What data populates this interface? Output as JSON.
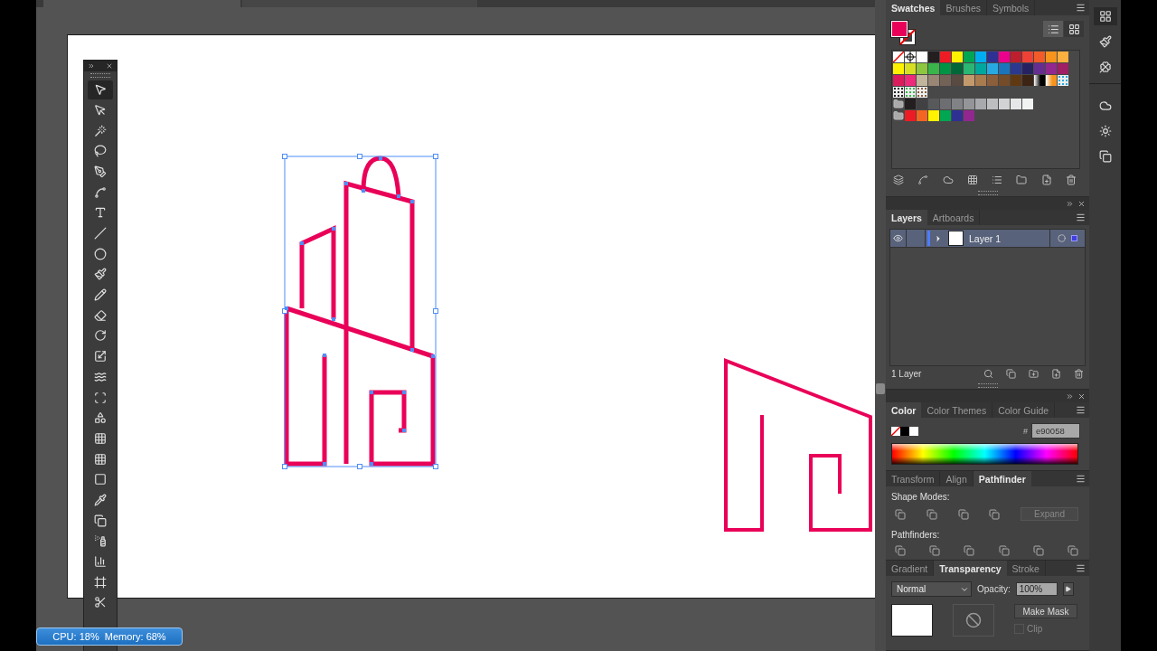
{
  "document_tabs": [
    {
      "selected": true
    },
    {
      "selected": false
    }
  ],
  "tools": [
    {
      "kind": "selection",
      "selected": true
    },
    {
      "kind": "direct-selection",
      "selected": false
    },
    {
      "kind": "magic-wand",
      "selected": false
    },
    {
      "kind": "lasso",
      "selected": false
    },
    {
      "kind": "pen",
      "selected": false
    },
    {
      "kind": "curvature",
      "selected": false
    },
    {
      "kind": "type",
      "selected": false
    },
    {
      "kind": "line",
      "selected": false
    },
    {
      "kind": "ellipse",
      "selected": false
    },
    {
      "kind": "paintbrush",
      "selected": false
    },
    {
      "kind": "pencil",
      "selected": false
    },
    {
      "kind": "eraser",
      "selected": false
    },
    {
      "kind": "rotate",
      "selected": false
    },
    {
      "kind": "scale",
      "selected": false
    },
    {
      "kind": "warp",
      "selected": false
    },
    {
      "kind": "free-transform",
      "selected": false
    },
    {
      "kind": "shape-builder",
      "selected": false
    },
    {
      "kind": "perspective",
      "selected": false
    },
    {
      "kind": "mesh",
      "selected": false
    },
    {
      "kind": "gradient",
      "selected": false
    },
    {
      "kind": "eyedropper",
      "selected": false
    },
    {
      "kind": "blend",
      "selected": false
    },
    {
      "kind": "symbol-sprayer",
      "selected": false
    },
    {
      "kind": "graph",
      "selected": false
    },
    {
      "kind": "artboard",
      "selected": false
    },
    {
      "kind": "slice",
      "selected": false
    }
  ],
  "swatches_panel": {
    "tabs": [
      {
        "label": "Swatches",
        "selected": true
      },
      {
        "label": "Brushes",
        "selected": false
      },
      {
        "label": "Symbols",
        "selected": false
      }
    ],
    "fill": {
      "color": "#e90058"
    },
    "rows": [
      [
        {
          "kind": "none"
        },
        {
          "kind": "registration"
        },
        {
          "kind": "solid",
          "color": "#ffffff"
        },
        {
          "kind": "solid",
          "color": "#231f20"
        },
        {
          "kind": "solid",
          "color": "#ed1c24"
        },
        {
          "kind": "solid",
          "color": "#fff200"
        },
        {
          "kind": "solid",
          "color": "#00a651"
        },
        {
          "kind": "solid",
          "color": "#00aeef"
        },
        {
          "kind": "solid",
          "color": "#2e3192"
        },
        {
          "kind": "solid",
          "color": "#ec008c"
        },
        {
          "kind": "solid",
          "color": "#be1e2d"
        },
        {
          "kind": "solid",
          "color": "#ef4136"
        },
        {
          "kind": "solid",
          "color": "#f15a29"
        },
        {
          "kind": "solid",
          "color": "#f7941d"
        },
        {
          "kind": "solid",
          "color": "#fbb040"
        }
      ],
      [
        {
          "kind": "solid",
          "color": "#fff200"
        },
        {
          "kind": "solid",
          "color": "#d7df23"
        },
        {
          "kind": "solid",
          "color": "#8dc63f"
        },
        {
          "kind": "solid",
          "color": "#39b54a"
        },
        {
          "kind": "solid",
          "color": "#009444"
        },
        {
          "kind": "solid",
          "color": "#006838"
        },
        {
          "kind": "solid",
          "color": "#2bb673"
        },
        {
          "kind": "solid",
          "color": "#00a79d"
        },
        {
          "kind": "solid",
          "color": "#27aae1"
        },
        {
          "kind": "solid",
          "color": "#1c75bc"
        },
        {
          "kind": "solid",
          "color": "#2b388f"
        },
        {
          "kind": "solid",
          "color": "#262262"
        },
        {
          "kind": "solid",
          "color": "#662d91"
        },
        {
          "kind": "solid",
          "color": "#92278f"
        },
        {
          "kind": "solid",
          "color": "#9e1f63"
        }
      ],
      [
        {
          "kind": "solid",
          "color": "#da1c5c"
        },
        {
          "kind": "solid",
          "color": "#ee2a7b"
        },
        {
          "kind": "solid",
          "color": "#c2b59b"
        },
        {
          "kind": "solid",
          "color": "#998675"
        },
        {
          "kind": "solid",
          "color": "#736357"
        },
        {
          "kind": "solid",
          "color": "#594a42"
        },
        {
          "kind": "solid",
          "color": "#c49a6c"
        },
        {
          "kind": "solid",
          "color": "#a97c50"
        },
        {
          "kind": "solid",
          "color": "#8b5e3c"
        },
        {
          "kind": "solid",
          "color": "#754c29"
        },
        {
          "kind": "solid",
          "color": "#603913"
        },
        {
          "kind": "solid",
          "color": "#3c2415"
        },
        {
          "kind": "gradient",
          "color": "#000000"
        },
        {
          "kind": "gradient",
          "color": "#f7941d"
        },
        {
          "kind": "pattern",
          "color": "#27aae1"
        }
      ],
      [
        {
          "kind": "pattern",
          "color": "#231f20"
        },
        {
          "kind": "pattern",
          "color": "#39b54a"
        },
        {
          "kind": "pattern",
          "color": "#8b5e3c"
        }
      ],
      [
        {
          "kind": "folder"
        },
        {
          "kind": "solid",
          "color": "#231f20"
        },
        {
          "kind": "solid",
          "color": "#414042"
        },
        {
          "kind": "solid",
          "color": "#58595b"
        },
        {
          "kind": "solid",
          "color": "#6d6e71"
        },
        {
          "kind": "solid",
          "color": "#808285"
        },
        {
          "kind": "solid",
          "color": "#939598"
        },
        {
          "kind": "solid",
          "color": "#a7a9ac"
        },
        {
          "kind": "solid",
          "color": "#bcbec0"
        },
        {
          "kind": "solid",
          "color": "#d1d3d4"
        },
        {
          "kind": "solid",
          "color": "#e6e7e8"
        },
        {
          "kind": "solid",
          "color": "#f1f2f2"
        }
      ],
      [
        {
          "kind": "folder"
        },
        {
          "kind": "solid",
          "color": "#ed1c24"
        },
        {
          "kind": "solid",
          "color": "#f26522"
        },
        {
          "kind": "solid",
          "color": "#fff200"
        },
        {
          "kind": "solid",
          "color": "#00a651"
        },
        {
          "kind": "solid",
          "color": "#2e3192"
        },
        {
          "kind": "solid",
          "color": "#92278f"
        }
      ]
    ]
  },
  "layers_panel": {
    "tabs": [
      {
        "label": "Layers",
        "selected": true
      },
      {
        "label": "Artboards",
        "selected": false
      }
    ],
    "layers": [
      {
        "name": "Layer 1",
        "visible": true,
        "selected": true
      }
    ],
    "footer": "1 Layer"
  },
  "color_panel": {
    "tabs": [
      {
        "label": "Color",
        "selected": true
      },
      {
        "label": "Color Themes",
        "selected": false
      },
      {
        "label": "Color Guide",
        "selected": false
      }
    ],
    "hash": "#",
    "hex": "e90058"
  },
  "pathfinder_panel": {
    "tabs": [
      {
        "label": "Transform",
        "selected": false
      },
      {
        "label": "Align",
        "selected": false
      },
      {
        "label": "Pathfinder",
        "selected": true
      }
    ],
    "shape_modes_label": "Shape Modes:",
    "pathfinders_label": "Pathfinders:",
    "expand_button": {
      "label": "Expand",
      "disabled": true
    }
  },
  "transparency_panel": {
    "tabs": [
      {
        "label": "Gradient",
        "selected": false
      },
      {
        "label": "Transparency",
        "selected": true
      },
      {
        "label": "Stroke",
        "selected": false
      }
    ],
    "blend_mode": "Normal",
    "opacity_label": "Opacity:",
    "opacity": "100%",
    "make_mask": "Make Mask",
    "clip": {
      "label": "Clip",
      "checked": false
    }
  },
  "status_badge": "CPU: 18%  Memory: 68%"
}
